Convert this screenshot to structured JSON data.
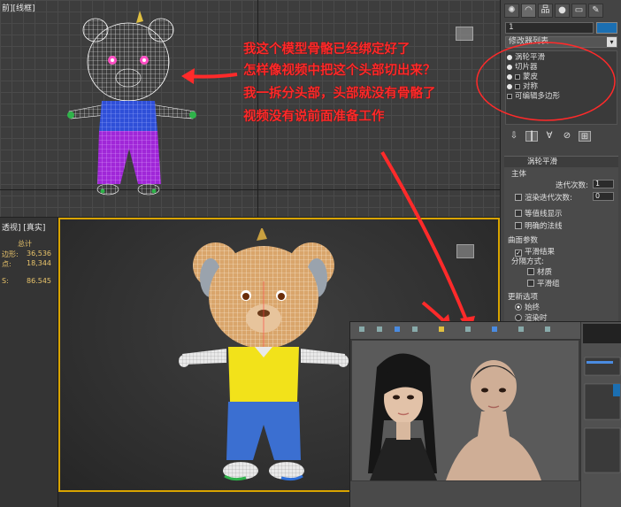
{
  "viewports": {
    "top_label": "前][线框]",
    "left_label": "透视] [真实]",
    "stats": {
      "total_label": "总计",
      "polys_label": "边形:",
      "polys_value": "36,536",
      "verts_label": "点:",
      "verts_value": "18,344",
      "fps_label": "S:",
      "fps_value": "86.545"
    }
  },
  "command_panel": {
    "tabs": [
      "✺",
      "◠",
      "品",
      "●",
      "▭",
      "✎"
    ],
    "object_name": "1",
    "color": "#1b6fb2",
    "modifier_list_label": "修改器列表",
    "modifier_stack": [
      {
        "label": "涡轮平滑",
        "bulb": true,
        "square": false
      },
      {
        "label": "切片器",
        "bulb": true,
        "square": false
      },
      {
        "label": "蒙皮",
        "bulb": true,
        "square": true
      },
      {
        "label": "对称",
        "bulb": true,
        "square": true
      },
      {
        "label": "可编辑多边形",
        "bulb": false,
        "square": true
      }
    ],
    "turbosmooth": {
      "rollout_title": "涡轮平滑",
      "main_label": "主体",
      "iterations_label": "迭代次数:",
      "iterations_value": "1",
      "render_iters_label": "渲染迭代次数:",
      "render_iters_value": "0",
      "isoline_label": "等值线显示",
      "explicit_normals_label": "明确的法线",
      "surface_params_label": "曲面参数",
      "smooth_result_label": "平滑结果",
      "separate_by_label": "分隔方式:",
      "materials_label": "材质",
      "smoothing_groups_label": "平滑组",
      "update_options_label": "更新选项",
      "always_label": "始终",
      "when_rendering_label": "渲染时"
    }
  },
  "annotations": [
    "我这个模型骨骼已经绑定好了",
    "怎样像视频中把这个头部切出来？",
    "我一拆分头部，头部就没有骨骼了",
    "视频没有说前面准备工作"
  ],
  "colors": {
    "annotation_red": "#ff2a2a",
    "active_viewport_border": "#d9a400",
    "bear_shirt": "#f2e21a",
    "bear_pants": "#3b6fd1",
    "wire_shirt": "#2f4fd8",
    "wire_pants": "#a027d8"
  }
}
